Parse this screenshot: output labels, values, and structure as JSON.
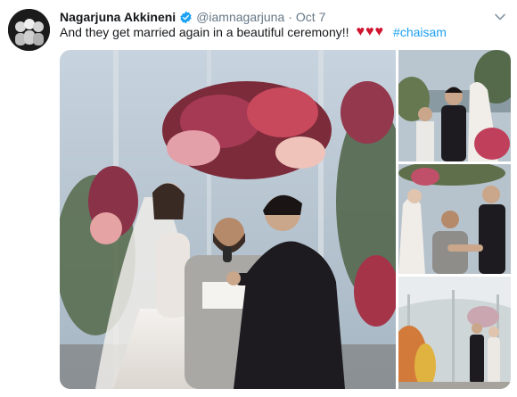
{
  "tweet": {
    "author_name": "Nagarjuna Akkineni",
    "handle": "@iamnagarjuna",
    "separator": "·",
    "date": "Oct 7",
    "text": "And they get married again in a beautiful ceremony!!",
    "hearts": "♥♥♥",
    "hashtag": "#chaisam",
    "verified": true,
    "colors": {
      "link": "#1da1f2",
      "secondary_text": "#657786",
      "heart": "#d0142f"
    }
  },
  "media": {
    "photo_count": 4
  }
}
